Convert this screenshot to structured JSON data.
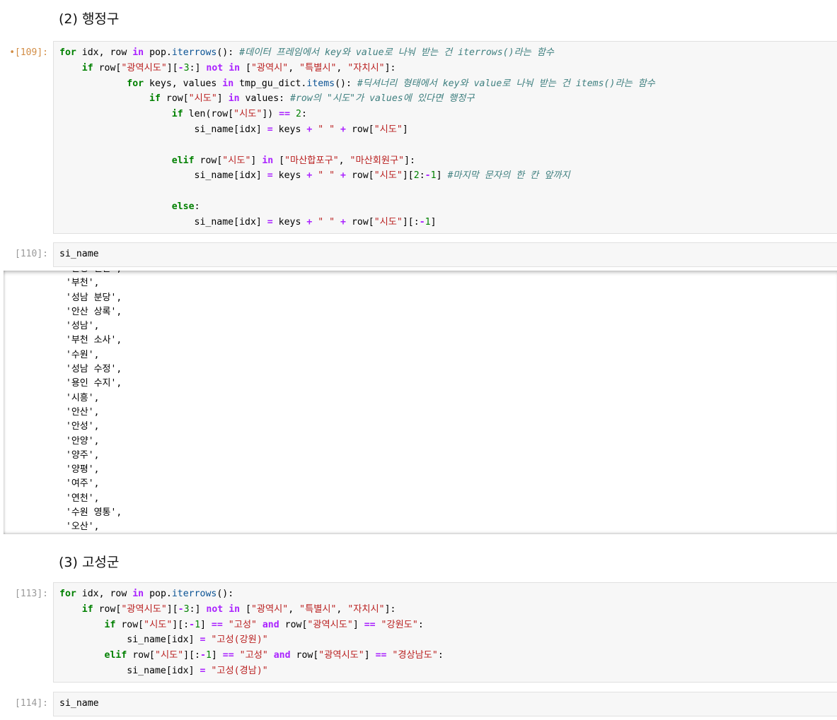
{
  "sections": {
    "haengjeonggu": "(2) 행정구",
    "goseong": "(3) 고성군"
  },
  "cells": {
    "c109": {
      "prompt": "•[109]:"
    },
    "c110": {
      "prompt": "[110]:",
      "code": "si_name"
    },
    "c113": {
      "prompt": "[113]:"
    },
    "c114": {
      "prompt": "[114]:",
      "code": "si_name"
    }
  },
  "output": {
    "lines": [
      "'안성 일산',",
      "'부천',",
      "'성남 분당',",
      "'안산 상록',",
      "'성남',",
      "'부천 소사',",
      "'수원',",
      "'성남 수정',",
      "'용인 수지',",
      "'시흥',",
      "'안산',",
      "'안성',",
      "'안양',",
      "'양주',",
      "'양평',",
      "'여주',",
      "'연천',",
      "'수원 영통',",
      "'오산',"
    ]
  }
}
